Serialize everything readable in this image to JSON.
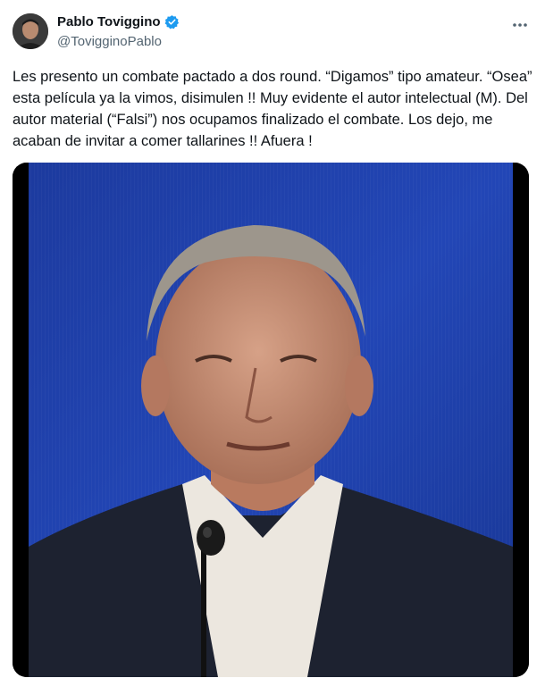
{
  "author": {
    "display_name": "Pablo Toviggino",
    "handle": "@TovigginoPablo",
    "verified": true
  },
  "tweet": {
    "text": "Les presento un combate pactado a dos round. “Digamos” tipo amateur. “Osea” esta película ya la vimos, disimulen !! Muy evidente el autor intelectual (M). Del autor material (“Falsi”) nos ocupamos finalizado el combate. Los dejo, me acaban de invitar a comer tallarines !! Afuera !"
  },
  "icons": {
    "more": "more-dots-icon",
    "verified": "verified-badge-icon"
  },
  "colors": {
    "verified_blue": "#1d9bf0",
    "secondary_text": "#536471",
    "video_background": "#1a3fa8"
  }
}
